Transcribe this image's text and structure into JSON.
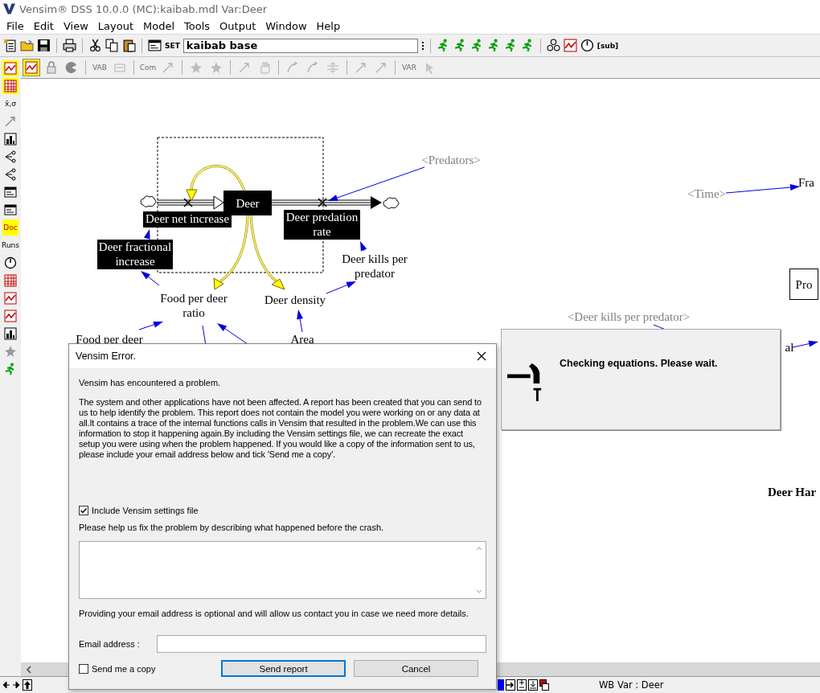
{
  "window": {
    "title": "Vensim® DSS 10.0.0 (MC):kaibab.mdl Var:Deer"
  },
  "menu": [
    "File",
    "Edit",
    "View",
    "Layout",
    "Model",
    "Tools",
    "Output",
    "Window",
    "Help"
  ],
  "main_toolbar": {
    "left_tools": [
      {
        "kind": "document"
      },
      {
        "kind": "folder"
      },
      {
        "kind": "disk"
      },
      {
        "kind": "sep"
      },
      {
        "kind": "printer"
      },
      {
        "kind": "sep"
      },
      {
        "kind": "scissors"
      },
      {
        "kind": "copy"
      },
      {
        "kind": "clipboard"
      },
      {
        "kind": "sep"
      },
      {
        "kind": "panel"
      },
      {
        "kind": "label",
        "label": "SET"
      }
    ],
    "run_name": "kaibab base",
    "right_tools": [
      {
        "kind": "runner"
      },
      {
        "kind": "runner"
      },
      {
        "kind": "runner"
      },
      {
        "kind": "runner"
      },
      {
        "kind": "runner"
      },
      {
        "kind": "runner"
      },
      {
        "kind": "sep"
      },
      {
        "kind": "network"
      },
      {
        "kind": "chart"
      },
      {
        "kind": "gauge"
      },
      {
        "kind": "label",
        "label": "[sub]"
      }
    ]
  },
  "sketch_toolbar": [
    {
      "kind": "chart",
      "on": true,
      "disabled": false
    },
    {
      "kind": "lock",
      "on": false,
      "disabled": false
    },
    {
      "kind": "circle",
      "on": false,
      "disabled": false
    },
    {
      "kind": "sep"
    },
    {
      "kind": "label",
      "label": "VAB",
      "on": false,
      "disabled": true
    },
    {
      "kind": "box",
      "on": false,
      "disabled": true
    },
    {
      "kind": "sep"
    },
    {
      "kind": "label",
      "label": "Com",
      "on": false,
      "disabled": true
    },
    {
      "kind": "arrow",
      "on": false,
      "disabled": true
    },
    {
      "kind": "sep"
    },
    {
      "kind": "star",
      "on": false,
      "disabled": true
    },
    {
      "kind": "star",
      "on": false,
      "disabled": true
    },
    {
      "kind": "sep"
    },
    {
      "kind": "arrow",
      "on": false,
      "disabled": true
    },
    {
      "kind": "hand",
      "on": false,
      "disabled": true
    },
    {
      "kind": "sep"
    },
    {
      "kind": "curve",
      "on": false,
      "disabled": true
    },
    {
      "kind": "curve",
      "on": false,
      "disabled": true
    },
    {
      "kind": "pipe",
      "on": false,
      "disabled": true
    },
    {
      "kind": "sep"
    },
    {
      "kind": "arrow",
      "on": false,
      "disabled": true
    },
    {
      "kind": "arrow",
      "on": false,
      "disabled": true
    },
    {
      "kind": "sep"
    },
    {
      "kind": "label",
      "label": "VAR",
      "on": false,
      "disabled": true
    },
    {
      "kind": "cursor",
      "on": false,
      "disabled": true
    }
  ],
  "analysis_toolbar": [
    {
      "kind": "chart",
      "on": true
    },
    {
      "kind": "table",
      "on": true
    },
    {
      "kind": "label",
      "label": "x̄,σ",
      "on": false
    },
    {
      "kind": "arrow",
      "on": false
    },
    {
      "kind": "bars",
      "on": false
    },
    {
      "kind": "tree",
      "on": false
    },
    {
      "kind": "tree",
      "on": false
    },
    {
      "kind": "panel",
      "on": false
    },
    {
      "kind": "panel",
      "on": false
    },
    {
      "kind": "label",
      "label": "Doc",
      "on": true
    },
    {
      "kind": "label",
      "label": "Runs",
      "on": false
    },
    {
      "kind": "gauge",
      "on": false
    },
    {
      "kind": "table",
      "on": false
    },
    {
      "kind": "chart",
      "on": false
    },
    {
      "kind": "chart",
      "on": false
    },
    {
      "kind": "bars",
      "on": false
    },
    {
      "kind": "star",
      "on": false
    },
    {
      "kind": "runner",
      "on": false
    }
  ],
  "diagram": {
    "variables": [
      {
        "kind": "stock",
        "label": "Deer",
        "selected": true
      },
      {
        "kind": "rate",
        "label": "Deer net increase",
        "selected": true
      },
      {
        "kind": "rate",
        "label": "Deer predation rate",
        "selected": true
      },
      {
        "kind": "aux",
        "label": "Deer fractional increase",
        "selected": true
      },
      {
        "kind": "aux",
        "label": "Food per deer ratio",
        "selected": false
      },
      {
        "kind": "aux",
        "label": "Deer density",
        "selected": false
      },
      {
        "kind": "aux",
        "label": "Deer kills per predator",
        "selected": false
      },
      {
        "kind": "shadow",
        "label": "<Predators>",
        "selected": false
      },
      {
        "kind": "aux",
        "label": "Food per deer",
        "selected": false
      },
      {
        "kind": "aux",
        "label": "Area",
        "selected": false
      },
      {
        "kind": "shadow",
        "label": "<Time>",
        "selected": false
      },
      {
        "kind": "aux",
        "label": "Fra",
        "selected": false
      },
      {
        "kind": "stock",
        "label": "Pro",
        "selected": false
      },
      {
        "kind": "shadow",
        "label": "<Deer kills per predator>",
        "selected": false
      },
      {
        "kind": "aux",
        "label": "al",
        "selected": false
      },
      {
        "kind": "heading",
        "label": "Deer Har",
        "selected": false
      }
    ]
  },
  "progress_dialog": {
    "message": "Checking equations. Please wait."
  },
  "error_dialog": {
    "title": "Vensim Error.",
    "intro": "Vensim has encountered a problem.",
    "body": "The system and other applications have not been affected. A report has been created that you can send to us to help identify the problem. This report does not contain the model you were working on or any data at all.It contains a trace of the internal functions calls in Vensim that resulted in the problem.We can use this information to stop it happening again.By including the Vensim settings file, we can recreate the exact setup you were using when the problem happened. If you would like a copy of the information sent to us, please include your email address below and tick 'Send me a copy'.",
    "include_settings": {
      "label": "Include Vensim settings file",
      "checked": true
    },
    "prompt": "Please help us fix the problem by describing what happened before the crash.",
    "email_note": "Providing your email address is optional and will allow us contact you in case we need more details.",
    "email_label": "Email address :",
    "send_copy": {
      "label": "Send me a copy",
      "checked": false
    },
    "buttons": [
      {
        "label": "Send report",
        "default": true
      },
      {
        "label": "Cancel",
        "default": false
      }
    ]
  },
  "status_bar": {
    "text": "WB Var : Deer"
  }
}
